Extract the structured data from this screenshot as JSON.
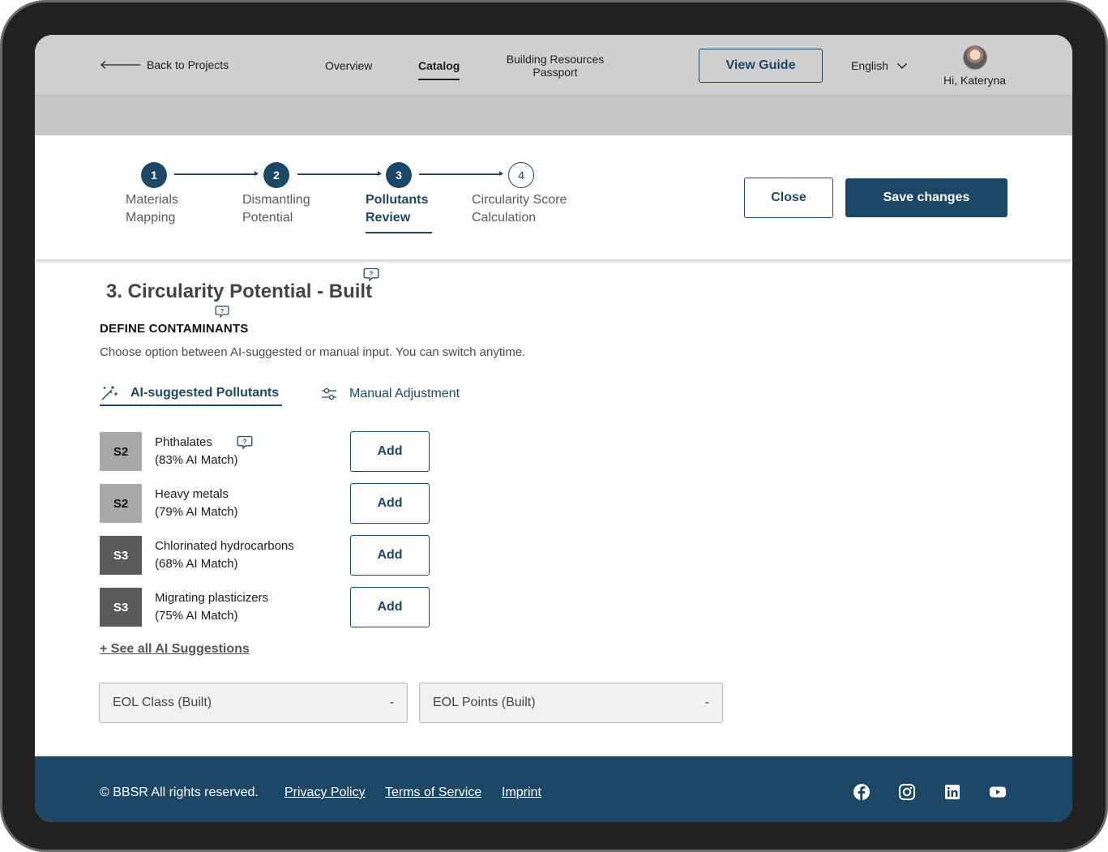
{
  "header": {
    "back_label": "Back to Projects",
    "nav": [
      "Overview",
      "Catalog",
      "Building Resources Passport"
    ],
    "view_guide": "View Guide",
    "language": "English",
    "greeting": "Hi, Kateryna"
  },
  "stepper": {
    "steps": [
      {
        "number": "1",
        "label_line1": "Materials",
        "label_line2": "Mapping"
      },
      {
        "number": "2",
        "label_line1": "Dismantling",
        "label_line2": "Potential"
      },
      {
        "number": "3",
        "label_line1": "Pollutants",
        "label_line2": "Review"
      },
      {
        "number": "4",
        "label_line1": "Circularity Score",
        "label_line2": "Calculation"
      }
    ],
    "close_label": "Close",
    "save_label": "Save changes"
  },
  "main": {
    "section_title": "3. Circularity Potential - Built",
    "contaminants_heading": "DEFINE CONTAMINANTS",
    "contaminants_desc": "Choose option between AI-suggested or manual input. You can switch anytime.",
    "tabs": [
      "AI-suggested Pollutants",
      "Manual Adjustment"
    ],
    "pollutants": [
      {
        "badge": "S2",
        "name": "Phthalates",
        "match": "(83% AI Match)",
        "action": "Add"
      },
      {
        "badge": "S2",
        "name": "Heavy metals",
        "match": "(79% AI Match)",
        "action": "Add"
      },
      {
        "badge": "S3",
        "name": "Chlorinated hydrocarbons",
        "match": "(68% AI Match)",
        "action": "Add"
      },
      {
        "badge": "S3",
        "name": "Migrating plasticizers",
        "match": "(75% AI Match)",
        "action": "Add"
      }
    ],
    "see_all": "+ See all AI Suggestions",
    "eol_class": {
      "label": "EOL Class (Built)",
      "value": "-"
    },
    "eol_points": {
      "label": "EOL Points (Built)",
      "value": "-"
    }
  },
  "footer": {
    "copyright": "© BBSR All rights reserved.",
    "links": [
      "Privacy Policy",
      "Terms of Service",
      "Imprint"
    ],
    "social_icons": [
      "facebook-icon",
      "instagram-icon",
      "linkedin-icon",
      "youtube-icon"
    ]
  },
  "colors": {
    "primary": "#1d4766",
    "header_bg": "#cfcfcf",
    "badge_s2": "#a8a8a8",
    "badge_s3": "#5a5a5a"
  }
}
